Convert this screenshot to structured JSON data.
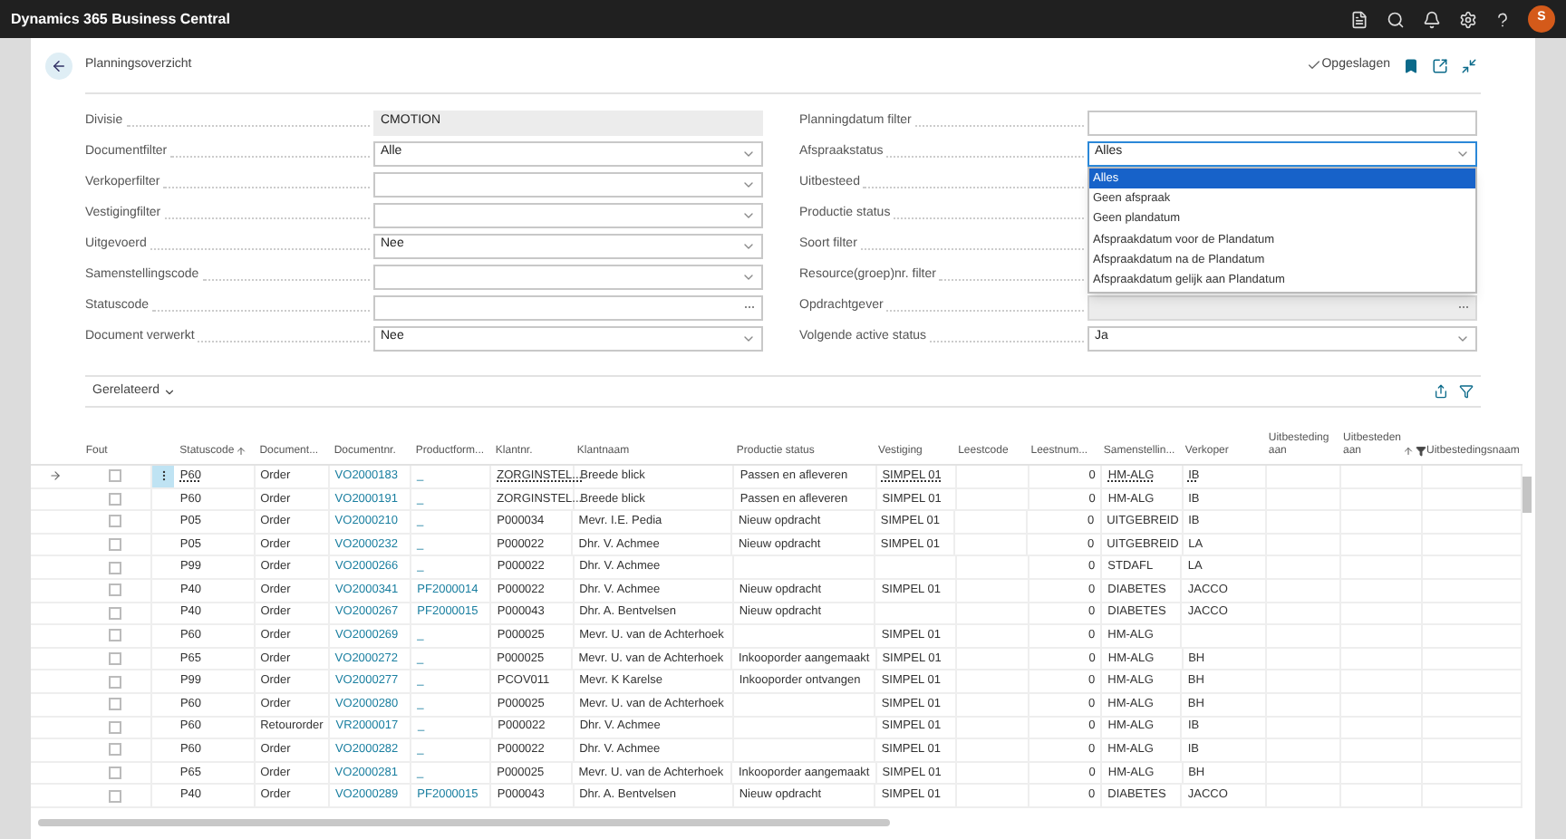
{
  "top_bar": {
    "title": "Dynamics 365 Business Central",
    "avatar": "S"
  },
  "page": {
    "title": "Planningsoverzicht",
    "save_status": "Opgeslagen"
  },
  "left_fields": [
    {
      "label": "Divisie",
      "value": "CMOTION",
      "kind": "readonly"
    },
    {
      "label": "Documentfilter",
      "value": "Alle",
      "kind": "dropdown"
    },
    {
      "label": "Verkoperfilter",
      "kind": "dropdown"
    },
    {
      "label": "Vestigingfilter",
      "kind": "dropdown"
    },
    {
      "label": "Uitgevoerd",
      "value": "Nee",
      "kind": "dropdown"
    },
    {
      "label": "Samenstellingscode",
      "kind": "dropdown"
    },
    {
      "label": "Statuscode",
      "kind": "lookup"
    },
    {
      "label": "Document verwerkt",
      "value": "Nee",
      "kind": "dropdown"
    }
  ],
  "right_fields": [
    {
      "label": "Planningdatum filter",
      "kind": "text"
    },
    {
      "label": "Afspraakstatus",
      "value": "Alles",
      "kind": "dropdown",
      "options": [
        {
          "label": "Alles",
          "selected": true
        },
        {
          "label": "Geen afspraak",
          "selected": false
        },
        {
          "label": "Geen plandatum",
          "selected": false
        },
        {
          "label": "Afspraakdatum voor de Plandatum",
          "selected": false
        },
        {
          "label": "Afspraakdatum na de Plandatum",
          "selected": false
        },
        {
          "label": "Afspraakdatum gelijk aan Plandatum",
          "selected": false
        }
      ]
    },
    {
      "label": "Uitbesteed",
      "kind": "hidden"
    },
    {
      "label": "Productie status",
      "kind": "hidden"
    },
    {
      "label": "Soort filter",
      "kind": "hidden"
    },
    {
      "label": "Resource(groep)nr. filter",
      "kind": "hidden"
    },
    {
      "label": "Opdrachtgever",
      "kind": "disabled"
    },
    {
      "label": "Volgende active status",
      "value": "Ja",
      "kind": "dropdown"
    }
  ],
  "related": {
    "label": "Gerelateerd"
  },
  "table": {
    "columns": [
      {
        "label": "Fout",
        "kind": "checkbox"
      },
      {
        "label": "Statuscode",
        "kind": "lookup",
        "sorted_ascending": true
      },
      {
        "label": "Document...",
        "kind": "text"
      },
      {
        "label": "Documentnr.",
        "kind": "link"
      },
      {
        "label": "Productform...",
        "kind": "link"
      },
      {
        "label": "Klantnr.",
        "kind": "lookup"
      },
      {
        "label": "Klantnaam",
        "kind": "text"
      },
      {
        "label": "Productie status",
        "kind": "text"
      },
      {
        "label": "Vestiging",
        "kind": "lookup"
      },
      {
        "label": "Leestcode",
        "kind": "text"
      },
      {
        "label": "Leestnum...",
        "kind": "number"
      },
      {
        "label": "Samenstellin...",
        "kind": "lookup"
      },
      {
        "label": "Verkoper",
        "kind": "lookup"
      },
      {
        "label": "Uitbesteding aan",
        "kind": "text"
      },
      {
        "label": "Uitbesteden aan",
        "kind": "text",
        "sorted_ascending": true,
        "filtered": true
      },
      {
        "label": "Uitbestedingsnaam",
        "kind": "text"
      }
    ],
    "rows": [
      {
        "selected": true,
        "error": false,
        "cells": [
          null,
          "P60",
          "Order",
          "VO2000183",
          "_",
          "ZORGINSTEL...",
          "Breede blick",
          "Passen en afleveren",
          "SIMPEL 01",
          null,
          "0",
          "HM-ALG",
          "IB",
          null,
          null,
          null
        ]
      },
      {
        "selected": false,
        "error": false,
        "cells": [
          null,
          "P60",
          "Order",
          "VO2000191",
          "_",
          "ZORGINSTEL...",
          "Breede blick",
          "Passen en afleveren",
          "SIMPEL 01",
          null,
          "0",
          "HM-ALG",
          "IB",
          null,
          null,
          null
        ]
      },
      {
        "selected": false,
        "error": false,
        "cells": [
          null,
          "P05",
          "Order",
          "VO2000210",
          "_",
          "P000034",
          "Mevr. I.E. Pedia",
          "Nieuw opdracht",
          "SIMPEL 01",
          null,
          "0",
          "UITGEBREID",
          "IB",
          null,
          null,
          null
        ]
      },
      {
        "selected": false,
        "error": false,
        "cells": [
          null,
          "P05",
          "Order",
          "VO2000232",
          "_",
          "P000022",
          "Dhr. V. Achmee",
          "Nieuw opdracht",
          "SIMPEL 01",
          null,
          "0",
          "UITGEBREID",
          "LA",
          null,
          null,
          null
        ]
      },
      {
        "selected": false,
        "error": false,
        "cells": [
          null,
          "P99",
          "Order",
          "VO2000266",
          "_",
          "P000022",
          "Dhr. V. Achmee",
          null,
          null,
          null,
          "0",
          "STDAFL",
          "LA",
          null,
          null,
          null
        ]
      },
      {
        "selected": false,
        "error": false,
        "cells": [
          null,
          "P40",
          "Order",
          "VO2000341",
          "PF2000014",
          "P000022",
          "Dhr. V. Achmee",
          "Nieuw opdracht",
          "SIMPEL 01",
          null,
          "0",
          "DIABETES",
          "JACCO",
          null,
          null,
          null
        ]
      },
      {
        "selected": false,
        "error": false,
        "cells": [
          null,
          "P40",
          "Order",
          "VO2000267",
          "PF2000015",
          "P000043",
          "Dhr. A. Bentvelsen",
          "Nieuw opdracht",
          null,
          null,
          "0",
          "DIABETES",
          "JACCO",
          null,
          null,
          null
        ]
      },
      {
        "selected": false,
        "error": false,
        "cells": [
          null,
          "P60",
          "Order",
          "VO2000269",
          "_",
          "P000025",
          "Mevr. U. van de Achterhoek",
          null,
          "SIMPEL 01",
          null,
          "0",
          "HM-ALG",
          null,
          null,
          null,
          null
        ]
      },
      {
        "selected": false,
        "error": false,
        "cells": [
          null,
          "P65",
          "Order",
          "VO2000272",
          "_",
          "P000025",
          "Mevr. U. van de Achterhoek",
          "Inkooporder aangemaakt",
          "SIMPEL 01",
          null,
          "0",
          "HM-ALG",
          "BH",
          null,
          null,
          null
        ]
      },
      {
        "selected": false,
        "error": false,
        "cells": [
          null,
          "P99",
          "Order",
          "VO2000277",
          "_",
          "PCOV011",
          "Mevr. K Karelse",
          "Inkooporder ontvangen",
          "SIMPEL 01",
          null,
          "0",
          "HM-ALG",
          "BH",
          null,
          null,
          null
        ]
      },
      {
        "selected": false,
        "error": false,
        "cells": [
          null,
          "P60",
          "Order",
          "VO2000280",
          "_",
          "P000025",
          "Mevr. U. van de Achterhoek",
          null,
          "SIMPEL 01",
          null,
          "0",
          "HM-ALG",
          "BH",
          null,
          null,
          null
        ]
      },
      {
        "selected": false,
        "error": false,
        "cells": [
          null,
          "P60",
          "Retourorder",
          "VR2000017",
          "_",
          "P000022",
          "Dhr. V. Achmee",
          null,
          "SIMPEL 01",
          null,
          "0",
          "HM-ALG",
          "IB",
          null,
          null,
          null
        ]
      },
      {
        "selected": false,
        "error": false,
        "cells": [
          null,
          "P60",
          "Order",
          "VO2000282",
          "_",
          "P000022",
          "Dhr. V. Achmee",
          null,
          "SIMPEL 01",
          null,
          "0",
          "HM-ALG",
          "IB",
          null,
          null,
          null
        ]
      },
      {
        "selected": false,
        "error": false,
        "cells": [
          null,
          "P65",
          "Order",
          "VO2000281",
          "_",
          "P000025",
          "Mevr. U. van de Achterhoek",
          "Inkooporder aangemaakt",
          "SIMPEL 01",
          null,
          "0",
          "HM-ALG",
          "BH",
          null,
          null,
          null
        ]
      },
      {
        "selected": false,
        "error": false,
        "cells": [
          null,
          "P40",
          "Order",
          "VO2000289",
          "PF2000015",
          "P000043",
          "Dhr. A. Bentvelsen",
          "Nieuw opdracht",
          "SIMPEL 01",
          null,
          "0",
          "DIABETES",
          "JACCO",
          null,
          null,
          null
        ]
      }
    ]
  }
}
